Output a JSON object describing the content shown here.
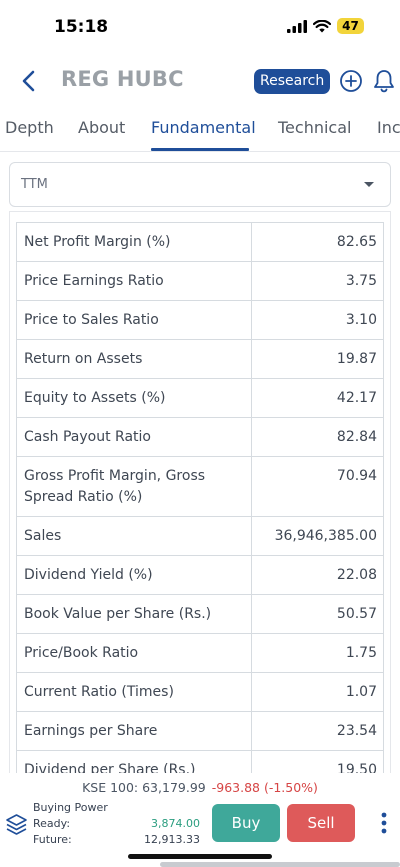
{
  "status": {
    "time": "15:18",
    "battery": "47",
    "icons": [
      "signal-icon",
      "wifi-icon",
      "battery-icon"
    ]
  },
  "header": {
    "title": "REG HUBC",
    "research_label": "Research",
    "icons": [
      "back-chevron-icon",
      "add-circle-icon",
      "bell-icon"
    ]
  },
  "tabs": [
    {
      "label": "Depth",
      "active": false
    },
    {
      "label": "About",
      "active": false
    },
    {
      "label": "Fundamental",
      "active": true
    },
    {
      "label": "Technical",
      "active": false
    },
    {
      "label": "Inc",
      "active": false
    }
  ],
  "period": {
    "selected": "TTM"
  },
  "metrics": [
    {
      "label": "Net Profit Margin (%)",
      "value": "82.65"
    },
    {
      "label": "Price Earnings Ratio",
      "value": "3.75"
    },
    {
      "label": "Price to Sales Ratio",
      "value": "3.10"
    },
    {
      "label": "Return on Assets",
      "value": "19.87"
    },
    {
      "label": "Equity to Assets (%)",
      "value": "42.17"
    },
    {
      "label": "Cash Payout Ratio",
      "value": "82.84"
    },
    {
      "label": "Gross Profit Margin, Gross Spread Ratio (%)",
      "value": "70.94"
    },
    {
      "label": "Sales",
      "value": "36,946,385.00"
    },
    {
      "label": "Dividend Yield (%)",
      "value": "22.08"
    },
    {
      "label": "Book Value per Share (Rs.)",
      "value": "50.57"
    },
    {
      "label": "Price/Book Ratio",
      "value": "1.75"
    },
    {
      "label": "Current Ratio (Times)",
      "value": "1.07"
    },
    {
      "label": "Earnings per Share",
      "value": "23.54"
    },
    {
      "label": "Dividend per Share (Rs.)",
      "value": "19.50"
    }
  ],
  "ticker": {
    "index": "KSE 100: 63,179.99",
    "change": "-963.88 (-1.50%)"
  },
  "buying_power": {
    "title": "Buying Power",
    "ready_label": "Ready:",
    "ready_value": "3,874.00",
    "future_label": "Future:",
    "future_value": "12,913.33"
  },
  "actions": {
    "buy_label": "Buy",
    "sell_label": "Sell"
  },
  "colors": {
    "brand_blue": "#1f4e99",
    "buy_green": "#3fa89a",
    "sell_red": "#de5a5a",
    "ready_green": "#2a9d7f",
    "negative_red": "#d64545"
  }
}
